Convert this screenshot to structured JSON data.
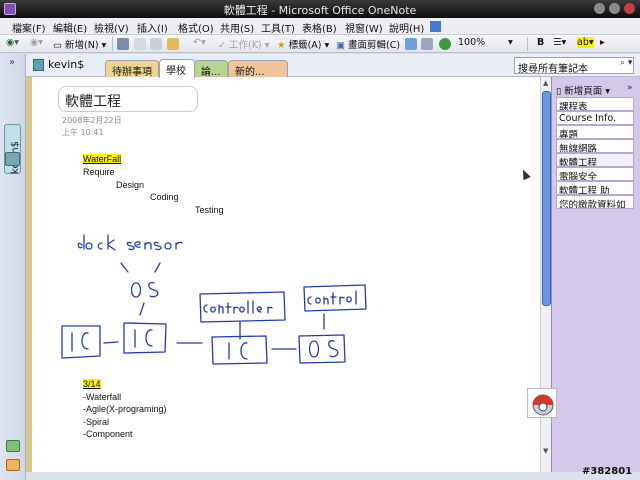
{
  "window": {
    "title": "軟體工程 - Microsoft Office OneNote"
  },
  "menu": [
    "檔案(F)",
    "編輯(E)",
    "檢視(V)",
    "插入(I)",
    "格式(O)",
    "共用(S)",
    "工具(T)",
    "表格(B)",
    "視窗(W)",
    "說明(H)"
  ],
  "toolbar": {
    "new_label": "新增(N)",
    "work_label": "工作(K)",
    "tags_label": "標籤(A)",
    "clip_label": "畫面剪輯(C)",
    "zoom": "100%",
    "bold": "B"
  },
  "notebook": {
    "name": "kevin$"
  },
  "sections": [
    "待辦事項",
    "學校",
    "論...",
    "新的..."
  ],
  "search": {
    "placeholder": "搜尋所有筆記本"
  },
  "page": {
    "title": "軟體工程",
    "date": "2008年2月22日",
    "time": "上午 10:41",
    "notes": {
      "waterfall_heading": "WaterFall",
      "step1": "Require",
      "step2": "Design",
      "step3": "Coding",
      "step4": "Testing",
      "date_heading": "3/14",
      "list1": "-Waterfall",
      "list2": "-Agile(X-programing)",
      "list3": "-Spiral",
      "list4": "-Component"
    }
  },
  "page_list": {
    "new_page_label": "新增頁面",
    "items": [
      "課程表",
      "Course Info.",
      "專題",
      "無線網路",
      "軟體工程",
      "電腦安全",
      "軟體工程 助",
      "您的繳款資料如"
    ]
  },
  "watermark": "#382801",
  "colors": {
    "title_bar": "#1a1a1a",
    "highlight": "#fff200",
    "scroll_thumb": "#6b97e0",
    "page_list_bg": "#d5c9ea",
    "ink": "#1f3fa8"
  }
}
